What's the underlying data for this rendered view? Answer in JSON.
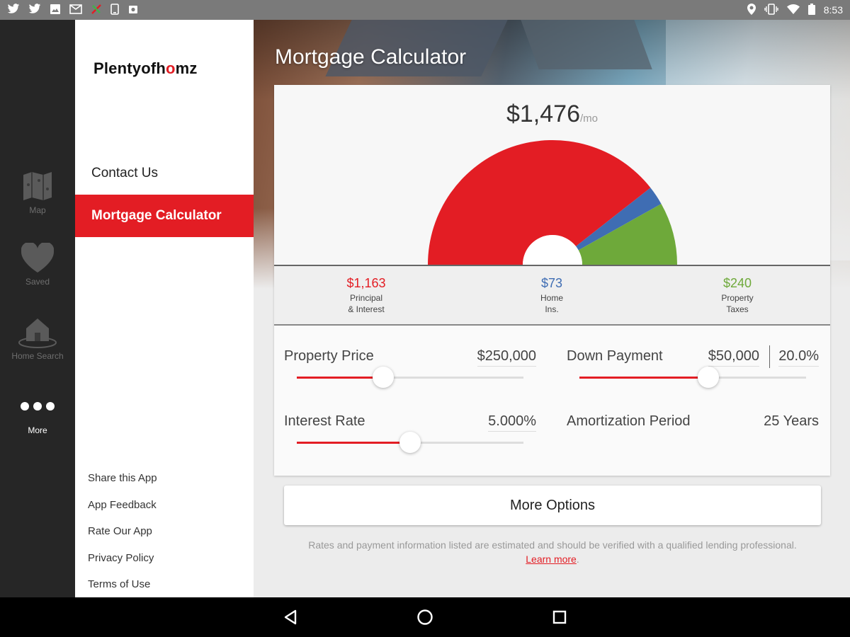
{
  "status_bar": {
    "time": "8:53",
    "left_icons": [
      "twitter-icon",
      "twitter-icon",
      "image-icon",
      "mail-icon",
      "app-icon",
      "phone-icon",
      "photos-icon"
    ],
    "right_icons": [
      "location-icon",
      "vibrate-icon",
      "wifi-icon",
      "battery-icon"
    ]
  },
  "rail": {
    "items": [
      {
        "label": "Map",
        "icon": "map-icon"
      },
      {
        "label": "Saved",
        "icon": "heart-icon"
      },
      {
        "label": "Home Search",
        "icon": "house-icon"
      },
      {
        "label": "More",
        "icon": "more-dots-icon"
      }
    ]
  },
  "drawer": {
    "logo": {
      "part1": "Plentyofh",
      "o": "o",
      "part2": "mz"
    },
    "items": [
      {
        "label": "Contact Us"
      },
      {
        "label": "Mortgage Calculator"
      }
    ],
    "links": [
      "Share this App",
      "App Feedback",
      "Rate Our App",
      "Privacy Policy",
      "Terms of Use"
    ]
  },
  "main": {
    "title": "Mortgage Calculator",
    "monthly_amount": "$1,476",
    "monthly_unit": "/mo",
    "breakdown": [
      {
        "value": "$1,163",
        "name_line1": "Principal",
        "name_line2": "& Interest",
        "color": "#e31d24"
      },
      {
        "value": "$73",
        "name_line1": "Home",
        "name_line2": "Ins.",
        "color": "#3f6db3"
      },
      {
        "value": "$240",
        "name_line1": "Property",
        "name_line2": "Taxes",
        "color": "#6ea93a"
      }
    ],
    "fields": {
      "property_price": {
        "label": "Property Price",
        "value": "$250,000",
        "slider_fraction": 0.38
      },
      "down_payment": {
        "label": "Down Payment",
        "value": "$50,000",
        "percent": "20.0%",
        "slider_fraction": 0.57
      },
      "interest_rate": {
        "label": "Interest Rate",
        "value": "5.000%",
        "slider_fraction": 0.5
      },
      "amortization": {
        "label": "Amortization Period",
        "value": "25 Years"
      }
    },
    "more_options": "More Options",
    "disclaimer": "Rates and payment information listed are estimated and should be verified with a qualified lending professional.",
    "learn_more": "Learn more",
    "disclaimer_end": "."
  },
  "nav_bar": {
    "icons": [
      "back-icon",
      "home-icon",
      "recents-icon"
    ]
  }
}
